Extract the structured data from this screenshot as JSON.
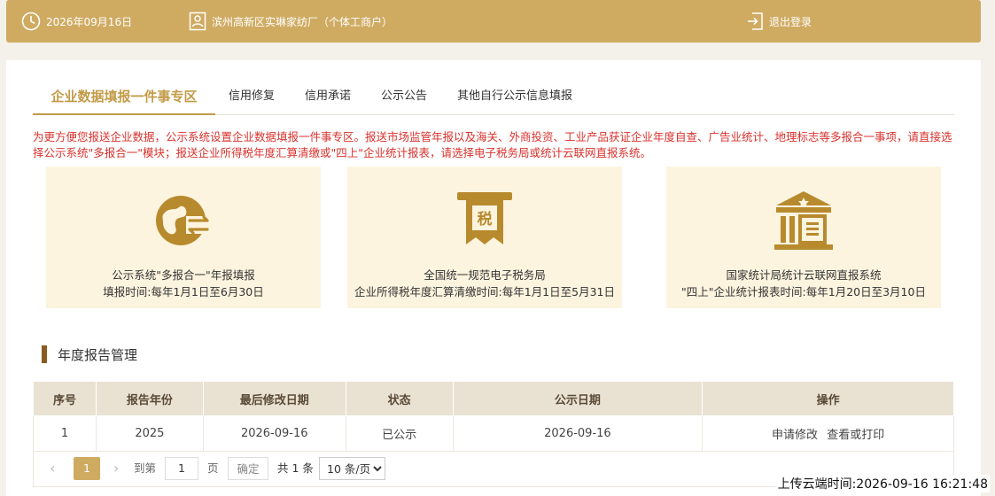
{
  "header": {
    "date": "2026年09月16日",
    "company": "滨州高新区实琳家纺厂（个体工商户）",
    "logout_label": "退出登录"
  },
  "tabs": [
    {
      "label": "企业数据填报一件事专区",
      "active": true
    },
    {
      "label": "信用修复",
      "active": false
    },
    {
      "label": "信用承诺",
      "active": false
    },
    {
      "label": "公示公告",
      "active": false
    },
    {
      "label": "其他自行公示信息填报",
      "active": false
    }
  ],
  "notice": "为更方便您报送企业数据，公示系统设置企业数据填报一件事专区。报送市场监管年报以及海关、外商投资、工业产品获证企业年度自查、广告业统计、地理标志等多报合一事项，请直接选择公示系统\"多报合一\"模块；报送企业所得税年度汇算清缴或\"四上\"企业统计报表，请选择电子税务局或统计云联网直报系统。",
  "cards": [
    {
      "icon": "globe-arrows-icon",
      "title": "公示系统\"多报合一\"年报填报",
      "subtitle": "填报时间:每年1月1日至6月30日"
    },
    {
      "icon": "tax-icon",
      "title": "全国统一规范电子税务局",
      "subtitle": "企业所得税年度汇算清缴时间:每年1月1日至5月31日"
    },
    {
      "icon": "bank-building-icon",
      "title": "国家统计局统计云联网直报系统",
      "subtitle": "\"四上\"企业统计报表时间:每年1月20日至3月10日"
    }
  ],
  "section_title": "年度报告管理",
  "table": {
    "headers": [
      "序号",
      "报告年份",
      "最后修改日期",
      "状态",
      "公示日期",
      "操作"
    ],
    "rows": [
      {
        "no": "1",
        "year": "2025",
        "modified": "2026-09-16",
        "status": "已公示",
        "publish_date": "2026-09-16",
        "actions": [
          "申请修改",
          "查看或打印"
        ]
      }
    ]
  },
  "pagination": {
    "prev": "‹",
    "current": "1",
    "next": "›",
    "goto_label": "到第",
    "goto_value": "1",
    "page_unit": "页",
    "confirm": "确定",
    "total": "共 1 条",
    "page_size": "10 条/页"
  },
  "upload_time": "上传云端时间:2026-09-16 16:21:48",
  "colors": {
    "accent": "#cfab62",
    "notice": "#d9312c",
    "card_bg": "#fdf4df",
    "icon": "#b88a2e"
  }
}
